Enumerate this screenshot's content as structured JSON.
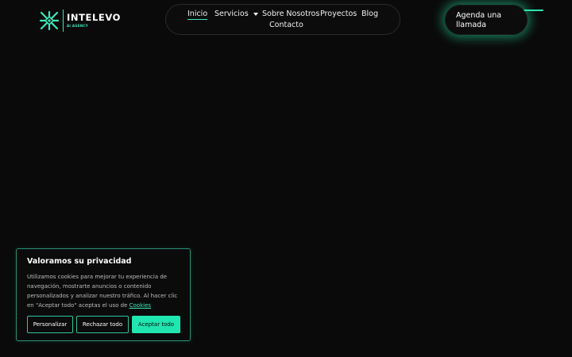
{
  "brand": {
    "name": "INTELEVO",
    "tagline": "AI AGENCY",
    "accent": "#3ee6b8"
  },
  "nav": {
    "items": [
      {
        "label": "Inicio",
        "active": true
      },
      {
        "label": "Servicios",
        "has_dropdown": true
      },
      {
        "label": "Sobre Nosotros"
      },
      {
        "label": "Proyectos"
      },
      {
        "label": "Blog"
      },
      {
        "label": "Contacto"
      }
    ]
  },
  "cta": {
    "line1": "Agenda una",
    "line2": "llamada"
  },
  "cookie": {
    "title": "Valoramos su privacidad",
    "text": "Utilizamos cookies para mejorar tu experiencia de navegación, mostrarte anuncios o contenido personalizados y analizar nuestro tráfico. Al hacer clic en \"Aceptar todo\" aceptas el uso de",
    "link": "Cookies",
    "buttons": {
      "customize": "Personalizar",
      "reject": "Rechazar todo",
      "accept": "Aceptar todo"
    }
  },
  "colors": {
    "background": "#0a0a0a",
    "accent": "#20e6b0",
    "border": "#2a8f75"
  }
}
